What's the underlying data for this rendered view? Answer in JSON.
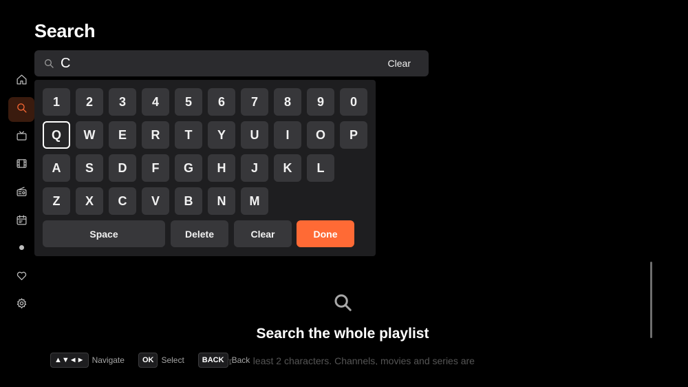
{
  "page": {
    "title": "Search"
  },
  "sidebar": {
    "items": [
      {
        "name": "home",
        "icon": "home-icon",
        "active": false
      },
      {
        "name": "search",
        "icon": "search-icon",
        "active": true
      },
      {
        "name": "live-tv",
        "icon": "tv-icon",
        "active": false
      },
      {
        "name": "movies",
        "icon": "film-icon",
        "active": false
      },
      {
        "name": "radio",
        "icon": "radio-icon",
        "active": false
      },
      {
        "name": "guide",
        "icon": "calendar-icon",
        "active": false
      },
      {
        "name": "record",
        "icon": "dot-icon",
        "active": false
      },
      {
        "name": "favorites",
        "icon": "heart-icon",
        "active": false
      },
      {
        "name": "settings",
        "icon": "gear-icon",
        "active": false
      }
    ]
  },
  "search": {
    "value": "C",
    "clear_label": "Clear"
  },
  "keyboard": {
    "rows": [
      [
        "1",
        "2",
        "3",
        "4",
        "5",
        "6",
        "7",
        "8",
        "9",
        "0"
      ],
      [
        "Q",
        "W",
        "E",
        "R",
        "T",
        "Y",
        "U",
        "I",
        "O",
        "P"
      ],
      [
        "A",
        "S",
        "D",
        "F",
        "G",
        "H",
        "J",
        "K",
        "L"
      ],
      [
        "Z",
        "X",
        "C",
        "V",
        "B",
        "N",
        "M"
      ]
    ],
    "focused_key": "Q",
    "space_label": "Space",
    "delete_label": "Delete",
    "clear_label": "Clear",
    "done_label": "Done"
  },
  "empty_state": {
    "title": "Search the whole playlist",
    "subtitle": "Type at least 2 characters. Channels, movies and series are"
  },
  "hints": [
    {
      "key": "▲▼◄►",
      "label": "Navigate"
    },
    {
      "key": "OK",
      "label": "Select"
    },
    {
      "key": "BACK",
      "label": "Back"
    }
  ],
  "colors": {
    "accent": "#ff6a35",
    "background": "#000000",
    "panel": "#1e1e20",
    "key": "#37373a"
  }
}
